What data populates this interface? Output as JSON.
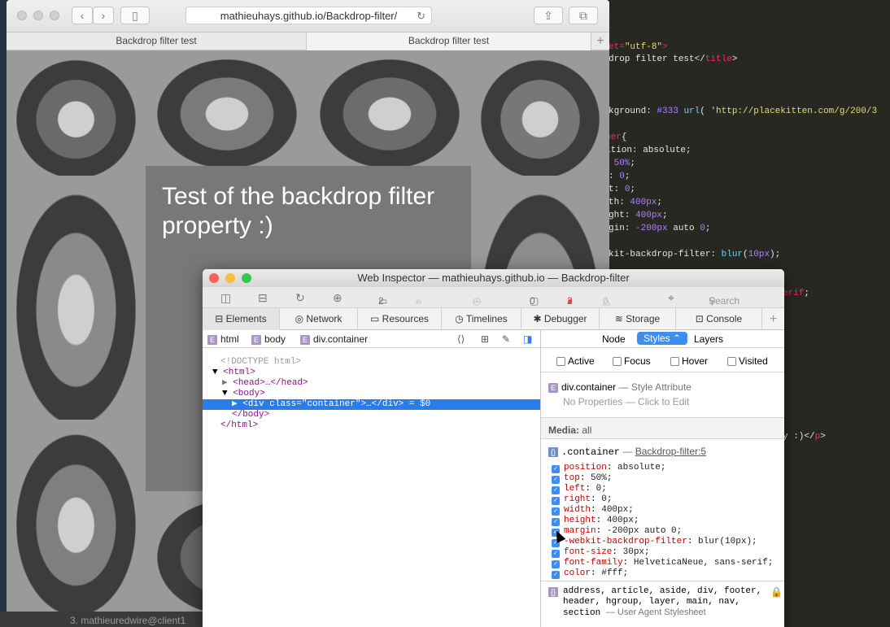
{
  "editor": {
    "lines": [
      {
        "parts": [
          [
            "kw",
            "et="
          ],
          [
            "st",
            "\"utf-8\""
          ],
          [
            "kw",
            ">"
          ]
        ]
      },
      {
        "parts": [
          [
            "pl",
            "drop filter test</"
          ],
          [
            "kw",
            "title"
          ],
          [
            "pl",
            ">"
          ]
        ]
      },
      {
        "parts": [
          [
            "pl",
            "kground: "
          ],
          [
            "nu",
            "#333"
          ],
          [
            "pl",
            " "
          ],
          [
            "fn",
            "url"
          ],
          [
            "pl",
            "( "
          ],
          [
            "st",
            "'http://placekitten.com/g/200/3"
          ]
        ]
      },
      {
        "parts": [
          [
            "kw",
            "ner"
          ],
          [
            "pl",
            "{"
          ]
        ]
      },
      {
        "parts": [
          [
            "pl",
            "ition: absolute;"
          ]
        ]
      },
      {
        "parts": [
          [
            "pl",
            " "
          ],
          [
            "nu",
            "50%"
          ],
          [
            "pl",
            ";"
          ]
        ]
      },
      {
        "parts": [
          [
            "pl",
            ": "
          ],
          [
            "nu",
            "0"
          ],
          [
            "pl",
            ";"
          ]
        ]
      },
      {
        "parts": [
          [
            "pl",
            "t: "
          ],
          [
            "nu",
            "0"
          ],
          [
            "pl",
            ";"
          ]
        ]
      },
      {
        "parts": [
          [
            "pl",
            "th: "
          ],
          [
            "nu",
            "400px"
          ],
          [
            "pl",
            ";"
          ]
        ]
      },
      {
        "parts": [
          [
            "pl",
            "ght: "
          ],
          [
            "nu",
            "400px"
          ],
          [
            "pl",
            ";"
          ]
        ]
      },
      {
        "parts": [
          [
            "pl",
            "gin: "
          ],
          [
            "nu",
            "-200px"
          ],
          [
            "pl",
            " auto "
          ],
          [
            "nu",
            "0"
          ],
          [
            "pl",
            ";"
          ]
        ]
      },
      {
        "parts": [
          [
            "pl",
            "kit-backdrop-filter: "
          ],
          [
            "fn",
            "blur"
          ],
          [
            "pl",
            "("
          ],
          [
            "nu",
            "10px"
          ],
          [
            "pl",
            ");"
          ]
        ]
      },
      {
        "parts": [
          [
            "kw",
            "erif"
          ],
          [
            "pl",
            ";"
          ]
        ]
      },
      {
        "parts": [
          [
            "pl",
            "y :)</"
          ],
          [
            "kw",
            "p"
          ],
          [
            "pl",
            ">"
          ]
        ]
      }
    ],
    "terminal_title": "3. mathieuredwire@client1"
  },
  "safari": {
    "url": "mathieuhays.github.io/Backdrop-filter/",
    "tabs": [
      "Backdrop filter test",
      "Backdrop filter test"
    ],
    "new_tab_label": "+",
    "page_text": "Test of the backdrop filter property :)"
  },
  "inspector": {
    "title": "Web Inspector — mathieuhays.github.io — Backdrop-filter",
    "toolbar": {
      "resources_count": "2",
      "timeline_label": "–",
      "time_label": "–",
      "logs_count": "0",
      "errors_count": "2",
      "warnings_count": "0",
      "search_placeholder": "Search"
    },
    "tabs": [
      "Elements",
      "Network",
      "Resources",
      "Timelines",
      "Debugger",
      "Storage",
      "Console"
    ],
    "add_tab": "+",
    "breadcrumbs": [
      "html",
      "body",
      "div.container"
    ],
    "dom": {
      "doctype": "<!DOCTYPE html>",
      "html_open": "<html>",
      "head": "<head>…</head>",
      "body_open": "<body>",
      "div_selected": "<div class=\"container\">…</div> = $0",
      "body_close": "</body>",
      "html_close": "</html>"
    },
    "sidebar": {
      "tabs": [
        "Node",
        "Styles",
        "Layers"
      ],
      "active_tab": "Styles",
      "states": [
        "Active",
        "Focus",
        "Hover",
        "Visited"
      ],
      "style_attr_selector": "div.container",
      "style_attr_label": "— Style Attribute",
      "style_attr_empty": "No Properties — Click to Edit",
      "media_label": "Media:",
      "media_value": "all",
      "rule_selector": ".container",
      "rule_source": "Backdrop-filter:5",
      "properties": [
        {
          "name": "position",
          "value": "absolute;"
        },
        {
          "name": "top",
          "value": "50%;"
        },
        {
          "name": "left",
          "value": "0;"
        },
        {
          "name": "right",
          "value": "0;"
        },
        {
          "name": "width",
          "value": "400px;"
        },
        {
          "name": "height",
          "value": "400px;"
        },
        {
          "name": "margin",
          "value": "-200px auto 0;"
        },
        {
          "name": "-webkit-backdrop-filter",
          "value": "blur(10px);"
        },
        {
          "name": "font-size",
          "value": "30px;"
        },
        {
          "name": "font-family",
          "value": "HelveticaNeue, sans-serif;"
        },
        {
          "name": "color",
          "value": "#fff;"
        }
      ],
      "ua_selectors": "address, article, aside, div, footer, header, hgroup, layer, main, nav,",
      "ua_selectors_2": "section",
      "ua_label": "— User Agent Stylesheet"
    }
  },
  "colors": {
    "accent": "#3e8ef0",
    "selection": "#2a7de9",
    "error": "#e0443e"
  }
}
